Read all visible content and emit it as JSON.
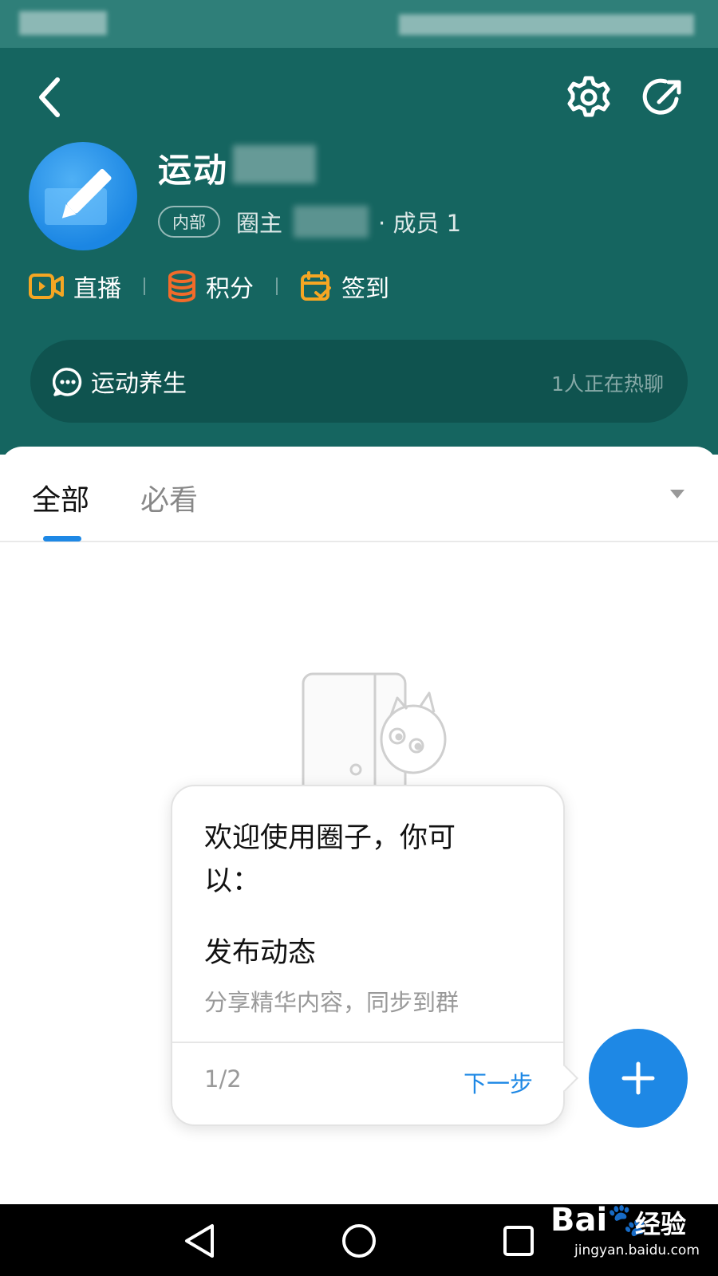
{
  "header": {
    "group_title": "运动",
    "tag": "内部",
    "owner_label": "圈主",
    "member_count": "· 成员 1"
  },
  "actions": [
    {
      "label": "直播",
      "icon": "video-icon",
      "color": "#f5a623"
    },
    {
      "label": "积分",
      "icon": "coins-icon",
      "color": "#f26b2a"
    },
    {
      "label": "签到",
      "icon": "calendar-check-icon",
      "color": "#f5a623"
    }
  ],
  "chat": {
    "name": "运动养生",
    "status": "1人正在热聊"
  },
  "tabs": [
    {
      "label": "全部",
      "active": true
    },
    {
      "label": "必看",
      "active": false
    }
  ],
  "guide": {
    "welcome": "欢迎使用圈子，你可以：",
    "heading": "发布动态",
    "description": "分享精华内容，同步到群",
    "page": "1/2",
    "next_label": "下一步"
  },
  "watermark": {
    "logo": "Bai",
    "logo_suffix": "经验",
    "domain": "jingyan.baidu.com"
  },
  "colors": {
    "header_bg": "#156560",
    "chat_bg": "#0f534f",
    "accent": "#1e88e5"
  }
}
